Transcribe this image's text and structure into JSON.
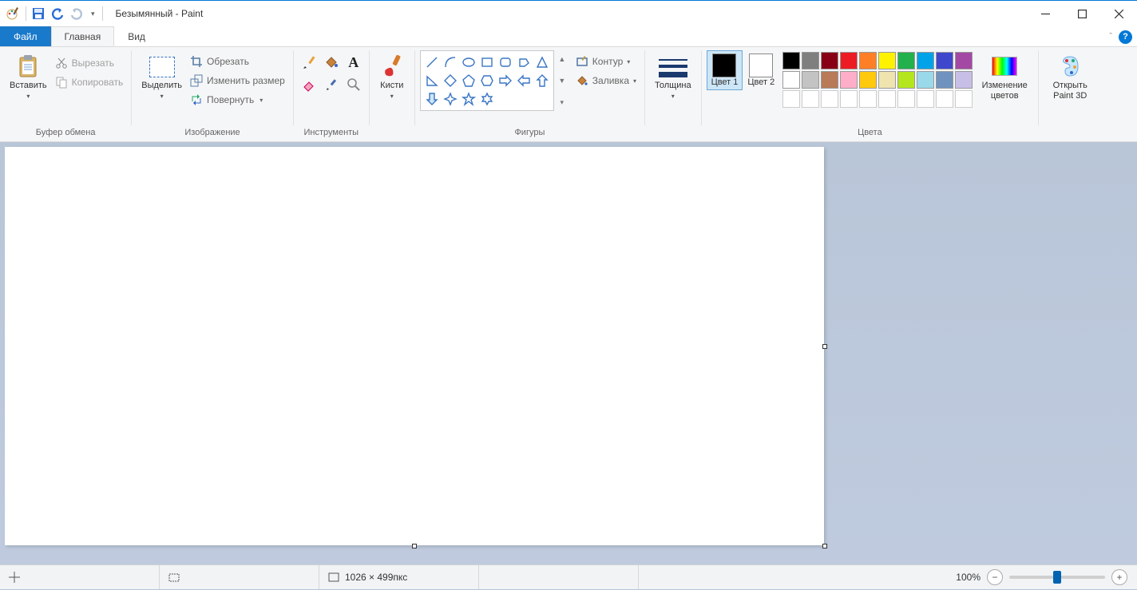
{
  "title": "Безымянный - Paint",
  "tabs": {
    "file": "Файл",
    "home": "Главная",
    "view": "Вид"
  },
  "groups": {
    "clipboard": {
      "label": "Буфер обмена",
      "paste": "Вставить",
      "cut": "Вырезать",
      "copy": "Копировать"
    },
    "image": {
      "label": "Изображение",
      "select": "Выделить",
      "crop": "Обрезать",
      "resize": "Изменить размер",
      "rotate": "Повернуть"
    },
    "tools": {
      "label": "Инструменты"
    },
    "brushes": {
      "label": "Кисти"
    },
    "shapes": {
      "label": "Фигуры",
      "outline": "Контур",
      "fill": "Заливка"
    },
    "thickness": {
      "label": "Толщина"
    },
    "colors": {
      "label": "Цвета",
      "color1": "Цвет 1",
      "color2": "Цвет 2",
      "edit": "Изменение цветов",
      "color1_value": "#000000",
      "color2_value": "#ffffff",
      "palette_row1": [
        "#000000",
        "#7f7f7f",
        "#880015",
        "#ed1c24",
        "#ff7f27",
        "#fff200",
        "#22b14c",
        "#00a2e8",
        "#3f48cc",
        "#a349a4"
      ],
      "palette_row2": [
        "#ffffff",
        "#c3c3c3",
        "#b97a57",
        "#ffaec9",
        "#ffc90e",
        "#efe4b0",
        "#b5e61d",
        "#99d9ea",
        "#7092be",
        "#c8bfe7"
      ]
    },
    "paint3d": {
      "open": "Открыть Paint 3D"
    }
  },
  "status": {
    "canvas_size": "1026 × 499пкс",
    "zoom": "100%"
  }
}
